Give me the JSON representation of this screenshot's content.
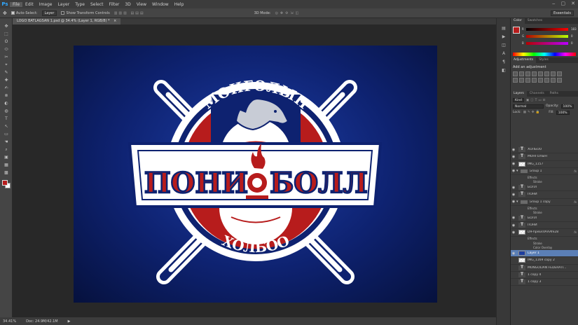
{
  "app": {
    "logo": "Ps"
  },
  "menu": [
    "File",
    "Edit",
    "Image",
    "Layer",
    "Type",
    "Select",
    "Filter",
    "3D",
    "View",
    "Window",
    "Help"
  ],
  "menu_active": 0,
  "window_controls": [
    "‒",
    "▢",
    "✕"
  ],
  "options": {
    "auto_select": "Auto-Select:",
    "auto_select_value": "Layer",
    "transform": "Show Transform Controls",
    "mode_3d": "3D Mode:",
    "workspace": "Essentials"
  },
  "document": {
    "tab_title": "LOGO BATLAGSAN 1.psd @ 34.4% (Layer 1, RGB/8) *",
    "close": "×"
  },
  "tools": [
    "✥",
    "⬚",
    "ʘ",
    "⬭",
    "✂",
    "⌖",
    "✎",
    "✚",
    "✍",
    "⊗",
    "◐",
    "◍",
    "T",
    "↖",
    "▭",
    "☚",
    "⌕",
    "▣",
    "▦",
    "▩"
  ],
  "status": {
    "zoom": "34.41%",
    "doc": "Doc: 24.9M/42.1M"
  },
  "side_icons": [
    "▤",
    "▶",
    "◫",
    "A",
    "¶",
    "◧"
  ],
  "logo": {
    "arc_top": "МОНГОЛЫН",
    "left_word": "ПОНИ",
    "right_word": "БОЛЛ",
    "arc_bottom": "ХОЛБОО"
  },
  "panels": {
    "color_tabs": [
      "Color",
      "Swatches"
    ],
    "color_sliders": [
      {
        "label": "R",
        "value": "183"
      },
      {
        "label": "G",
        "value": "0"
      },
      {
        "label": "B",
        "value": "0"
      }
    ],
    "adj_tabs": [
      "Adjustments",
      "Styles"
    ],
    "adj_title": "Add an adjustment",
    "layers_tabs": [
      "Layers",
      "Channels",
      "Paths"
    ],
    "kind": "Kind",
    "blend_mode": "Normal",
    "opacity_label": "Opacity:",
    "opacity": "100%",
    "lock_label": "Lock:",
    "fill_label": "Fill:",
    "fill": "100%"
  },
  "layers": [
    {
      "name": "ХОЛБОО",
      "type": "t",
      "kind": "layer",
      "eye": true
    },
    {
      "name": "МОНГОЛЫН",
      "type": "t",
      "kind": "layer",
      "eye": true
    },
    {
      "name": "IMG_1157",
      "type": "checker",
      "kind": "layer",
      "eye": true
    },
    {
      "name": "Group 1",
      "type": "folder",
      "kind": "layer",
      "eye": true,
      "fx": "fx"
    },
    {
      "name": "Effects",
      "kind": "sub"
    },
    {
      "name": "Stroke",
      "kind": "sub"
    },
    {
      "name": "БОЛЛ",
      "type": "t",
      "kind": "layer",
      "eye": true
    },
    {
      "name": "ПОНИ",
      "type": "t",
      "kind": "layer",
      "eye": true
    },
    {
      "name": "Group 1 copy",
      "type": "folder",
      "kind": "layer",
      "eye": true,
      "fx": "fx"
    },
    {
      "name": "Effects",
      "kind": "sub"
    },
    {
      "name": "Stroke",
      "kind": "sub"
    },
    {
      "name": "БОЛЛ",
      "type": "t",
      "kind": "layer",
      "eye": true
    },
    {
      "name": "ПОНИ",
      "type": "t",
      "kind": "layer",
      "eye": true
    },
    {
      "name": "D9-hpeEkVAAAfe28",
      "type": "checker",
      "kind": "layer",
      "eye": true,
      "fx": "fx"
    },
    {
      "name": "Effects",
      "kind": "sub"
    },
    {
      "name": "Stroke",
      "kind": "sub"
    },
    {
      "name": "Color Overlay",
      "kind": "sub"
    },
    {
      "name": "Layer 1",
      "type": "layerimg",
      "kind": "layer",
      "eye": true,
      "selected": true
    },
    {
      "name": "IMG_1169 copy 2",
      "type": "checker",
      "kind": "layer",
      "eye": false
    },
    {
      "name": "MONGOLIAN FEDERATI...",
      "type": "t",
      "kind": "layer",
      "eye": false
    },
    {
      "name": "1 copy 4",
      "type": "t",
      "kind": "layer",
      "eye": false
    },
    {
      "name": "1 copy 3",
      "type": "t",
      "kind": "layer",
      "eye": false
    }
  ],
  "colors": {
    "navy": "#0e2270",
    "red": "#b71c1c",
    "selection": "#5b7fb6"
  }
}
